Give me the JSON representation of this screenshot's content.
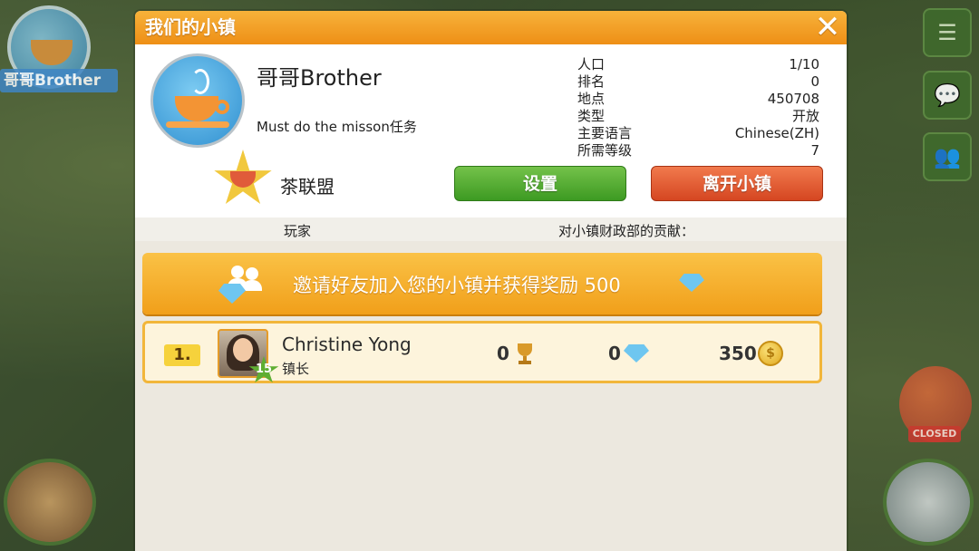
{
  "background": {
    "corner_player_name": "哥哥Brother",
    "closed_sign": "CLOSED"
  },
  "dialog": {
    "title": "我们的小镇",
    "close_label": "✕",
    "town": {
      "name": "哥哥Brother",
      "description": "Must do the misson任务",
      "stats": [
        {
          "label": "人口",
          "value": "1/10"
        },
        {
          "label": "排名",
          "value": "0"
        },
        {
          "label": "地点",
          "value": "450708"
        },
        {
          "label": "类型",
          "value": "开放"
        },
        {
          "label": "主要语言",
          "value": "Chinese(ZH)"
        },
        {
          "label": "所需等级",
          "value": "7"
        }
      ],
      "alliance_name": "茶联盟"
    },
    "buttons": {
      "settings": "设置",
      "leave": "离开小镇"
    },
    "columns": {
      "player": "玩家",
      "contribution": "对小镇财政部的贡献："
    },
    "invite": {
      "text": "邀请好友加入您的小镇并获得奖励 500"
    },
    "members": [
      {
        "rank": "1.",
        "level": "15",
        "name": "Christine Yong",
        "role": "镇长",
        "trophies": "0",
        "diamonds": "0",
        "coins": "350"
      }
    ]
  },
  "colors": {
    "title_bar": "#ee8f16",
    "settings_button": "#3d9a22",
    "leave_button": "#d54621",
    "invite_banner": "#f19f1a",
    "member_row_border": "#f2b63a"
  }
}
